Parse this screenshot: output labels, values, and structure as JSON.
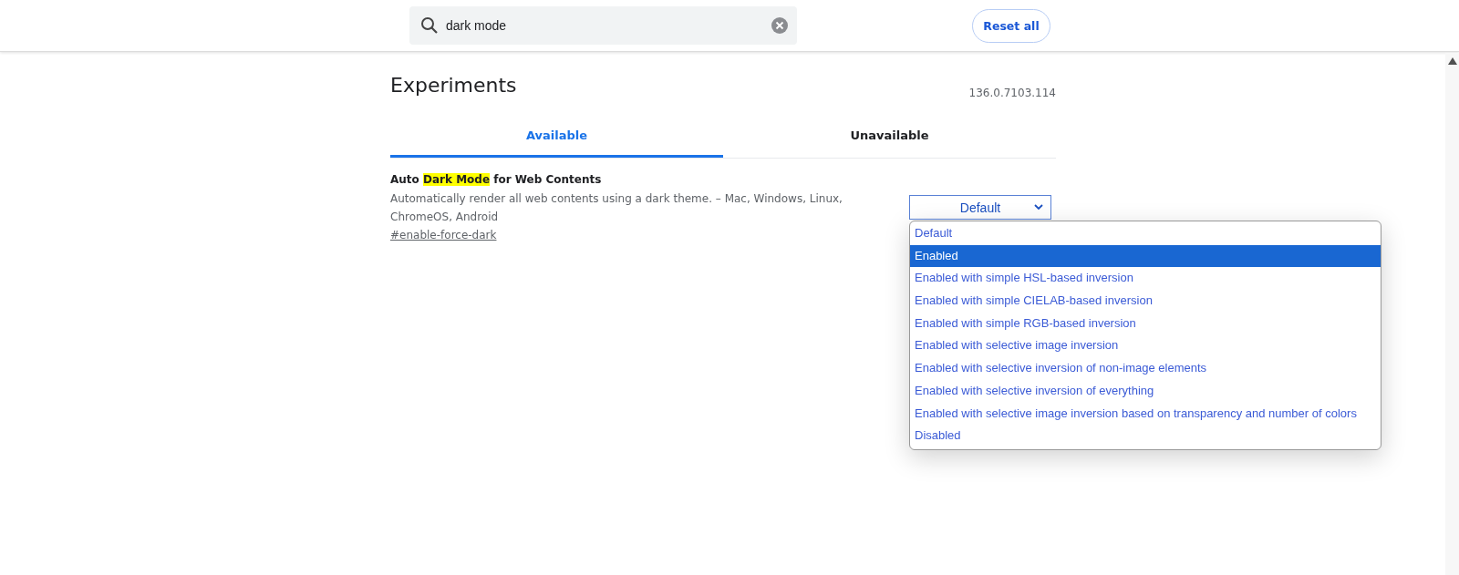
{
  "search": {
    "value": "dark mode"
  },
  "reset_button": "Reset all",
  "heading": "Experiments",
  "version": "136.0.7103.114",
  "tabs": [
    {
      "label": "Available",
      "selected": true
    },
    {
      "label": "Unavailable",
      "selected": false
    }
  ],
  "experiments": [
    {
      "title_parts": [
        {
          "text": "Auto ",
          "highlighted": false
        },
        {
          "text": "Dark Mode",
          "highlighted": true
        },
        {
          "text": " for Web Contents",
          "highlighted": false
        }
      ],
      "description": "Automatically render all web contents using a dark theme. – Mac, Windows, Linux, ChromeOS, Android",
      "link": "#enable-force-dark",
      "select_value": "Default",
      "dropdown_open": true,
      "options": [
        {
          "label": "Default",
          "selected": false
        },
        {
          "label": "Enabled",
          "selected": true
        },
        {
          "label": "Enabled with simple HSL-based inversion",
          "selected": false
        },
        {
          "label": "Enabled with simple CIELAB-based inversion",
          "selected": false
        },
        {
          "label": "Enabled with simple RGB-based inversion",
          "selected": false
        },
        {
          "label": "Enabled with selective image inversion",
          "selected": false
        },
        {
          "label": "Enabled with selective inversion of non-image elements",
          "selected": false
        },
        {
          "label": "Enabled with selective inversion of everything",
          "selected": false
        },
        {
          "label": "Enabled with selective image inversion based on transparency and number of colors",
          "selected": false
        },
        {
          "label": "Disabled",
          "selected": false
        }
      ]
    }
  ]
}
